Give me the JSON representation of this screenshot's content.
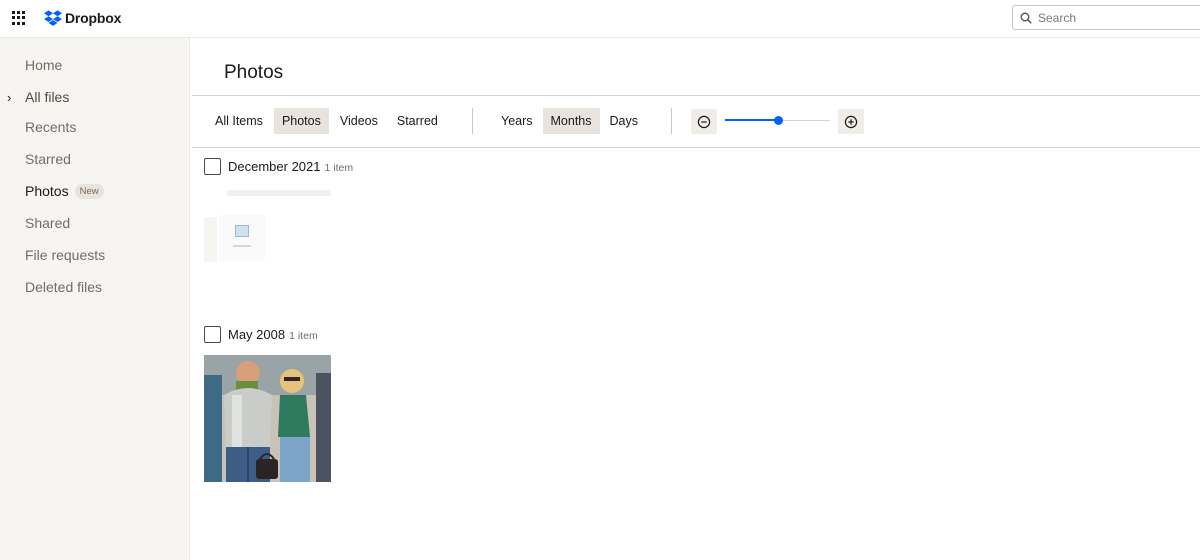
{
  "app": {
    "name": "Dropbox",
    "accent": "#0061fe"
  },
  "header": {
    "apps_icon": "grid-icon",
    "logo_text": "Dropbox",
    "search": {
      "placeholder": "Search",
      "value": "",
      "icon": "search-icon"
    }
  },
  "sidebar": {
    "items": [
      {
        "label": "Home"
      },
      {
        "label": "All files",
        "expand_icon": "chevron-right-icon"
      },
      {
        "label": "Recents"
      },
      {
        "label": "Starred"
      },
      {
        "label": "Photos",
        "badge": "New",
        "active": true
      },
      {
        "label": "Shared"
      },
      {
        "label": "File requests"
      },
      {
        "label": "Deleted files"
      }
    ]
  },
  "main": {
    "title": "Photos",
    "filters": [
      {
        "label": "All Items"
      },
      {
        "label": "Photos",
        "selected": true
      },
      {
        "label": "Videos"
      },
      {
        "label": "Starred"
      }
    ],
    "groupings": [
      {
        "label": "Years"
      },
      {
        "label": "Months",
        "selected": true
      },
      {
        "label": "Days"
      }
    ],
    "zoom": {
      "out_icon": "zoom-out-icon",
      "in_icon": "zoom-in-icon",
      "level": 0.5
    },
    "groups": [
      {
        "title": "December 2021",
        "count": "1 item",
        "thumbnail": "screenshot"
      },
      {
        "title": "May 2008",
        "count": "1 item",
        "thumbnail": "photo"
      }
    ]
  }
}
